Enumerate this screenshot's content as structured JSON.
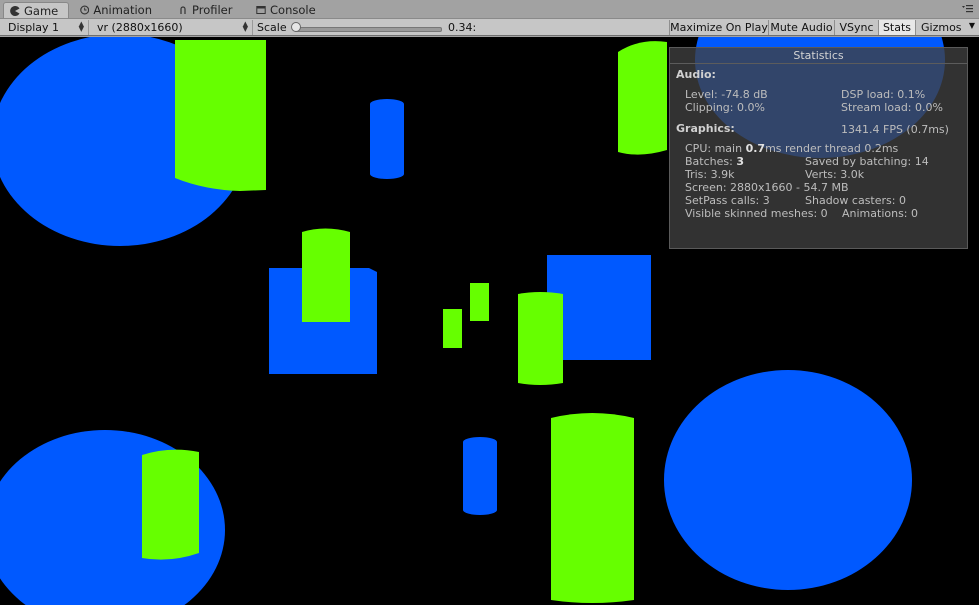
{
  "tabs": [
    {
      "label": "Game",
      "icon": "pacman-icon",
      "active": true
    },
    {
      "label": "Animation",
      "icon": "clock-icon",
      "active": false
    },
    {
      "label": "Profiler",
      "icon": "profiler-icon",
      "active": false
    },
    {
      "label": "Console",
      "icon": "console-icon",
      "active": false
    }
  ],
  "toolbar": {
    "display": "Display 1",
    "resolution": "vr (2880x1660)",
    "scale_label": "Scale",
    "scale_value": "0.34:",
    "scale_fraction": 0.01,
    "maximize": "Maximize On Play",
    "mute": "Mute Audio",
    "vsync": "VSync",
    "stats": "Stats",
    "gizmos": "Gizmos"
  },
  "stats": {
    "title": "Statistics",
    "audio_heading": "Audio:",
    "level": "Level: -74.8 dB",
    "dsp": "DSP load: 0.1%",
    "clipping": "Clipping: 0.0%",
    "stream": "Stream load: 0.0%",
    "graphics_heading": "Graphics:",
    "fps": "1341.4 FPS (0.7ms)",
    "cpu_prefix": "CPU: main ",
    "cpu_main": "0.7",
    "cpu_suffix": "ms  render thread 0.2ms",
    "batches_prefix": "Batches: ",
    "batches": "3",
    "saved": "Saved by batching: 14",
    "tris": "Tris: 3.9k",
    "verts": "Verts: 3.0k",
    "screen": "Screen: 2880x1660 - 54.7 MB",
    "setpass": "SetPass calls: 3",
    "shadow": "Shadow casters: 0",
    "skinned": "Visible skinned meshes: 0",
    "animations": "Animations: 0"
  },
  "colors": {
    "blue": "#0059ff",
    "green": "#66ff00",
    "background": "#000000"
  }
}
